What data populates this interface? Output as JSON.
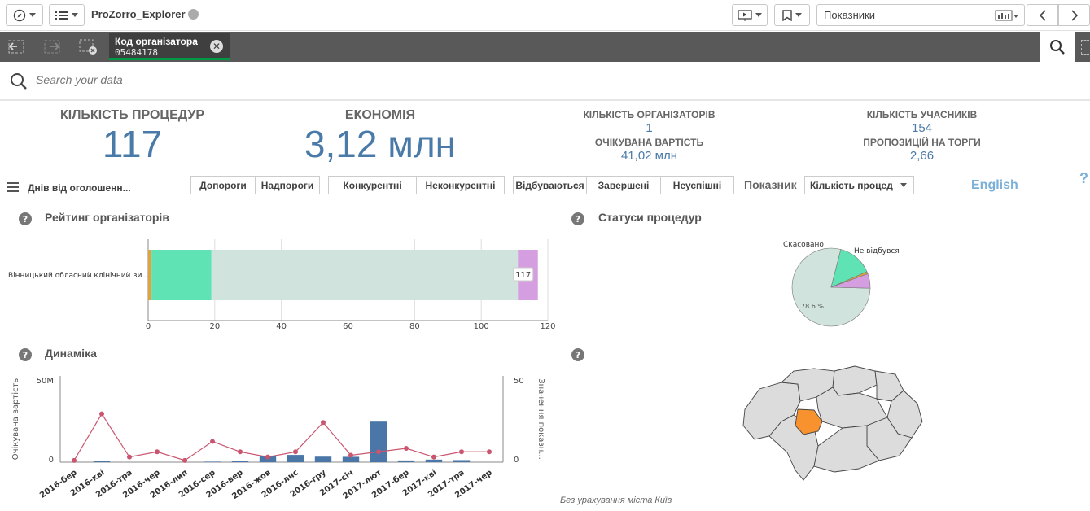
{
  "toolbar": {
    "app_title": "ProZorro_Explorer",
    "sheet_name": "Показники"
  },
  "selection": {
    "field": "Код організатора",
    "value": "05484178"
  },
  "search": {
    "placeholder": "Search your data"
  },
  "kpis": {
    "procedures_title": "КІЛЬКІСТЬ ПРОЦЕДУР",
    "procedures_value": "117",
    "savings_title": "ЕКОНОМІЯ",
    "savings_value": "3,12 млн",
    "organizers_title": "КІЛЬКІСТЬ ОРГАНІЗАТОРІВ",
    "organizers_value": "1",
    "expected_title": "ОЧІКУВАНА ВАРТІСТЬ",
    "expected_value": "41,02 млн",
    "participants_title": "КІЛЬКІСТЬ УЧАСНИКІВ",
    "participants_value": "154",
    "bids_title": "ПРОПОЗИЦІЙ НА ТОРГИ",
    "bids_value": "2,66"
  },
  "filters": {
    "days_label": "Днів від оголошенн...",
    "threshold": [
      "Допороги",
      "Надпороги"
    ],
    "competition": [
      "Конкурентні",
      "Неконкурентні"
    ],
    "status": [
      "Відбуваються",
      "Завершені",
      "Неуспішні"
    ],
    "indicator_label": "Показник",
    "indicator_value": "Кількість процед",
    "language_link": "English",
    "help_link": "?"
  },
  "panels": {
    "rating_title": "Рейтинг організаторів",
    "status_title": "Статуси процедур",
    "dynamics_title": "Динаміка",
    "map_note": "Без урахування міста Київ"
  },
  "colors": {
    "accent_blue": "#4a7ba8",
    "selection_green": "#009845",
    "map_highlight": "#f7922e"
  },
  "chart_data": [
    {
      "type": "bar",
      "orientation": "horizontal",
      "stacked": true,
      "categories": [
        "Вінницький обласний клінічний ви..."
      ],
      "series": [
        {
          "color": "#e3a33a",
          "values": [
            1
          ]
        },
        {
          "color": "#5fe3b4",
          "values": [
            18
          ]
        },
        {
          "color": "#d0e3dc",
          "values": [
            92
          ]
        },
        {
          "color": "#d59ee0",
          "values": [
            6
          ]
        }
      ],
      "total_labels": [
        "117"
      ],
      "xticks": [
        0,
        20,
        40,
        60,
        80,
        100,
        120
      ],
      "xlim": [
        0,
        120
      ]
    },
    {
      "type": "pie",
      "labels": [
        "Скасовано",
        "Не відбувся"
      ],
      "slices": [
        {
          "label": "",
          "value": 78.6,
          "color": "#d0e3dc",
          "data_label": "78.6 %"
        },
        {
          "label": "Не відбувся",
          "value": 14.5,
          "color": "#5fe3b4",
          "data_label": ""
        },
        {
          "label": "",
          "value": 0.9,
          "color": "#e3a33a",
          "data_label": ""
        },
        {
          "label": "Скасовано",
          "value": 6.0,
          "color": "#d59ee0",
          "data_label": ""
        }
      ]
    },
    {
      "type": "bar",
      "combo": true,
      "categories": [
        "2016-бер",
        "2016-кві",
        "2016-тра",
        "2016-чер",
        "2016-лип",
        "2016-сер",
        "2016-вер",
        "2016-жов",
        "2016-лис",
        "2016-гру",
        "2017-січ",
        "2017-лют",
        "2017-бер",
        "2017-кві",
        "2017-тра",
        "2017-чер"
      ],
      "ylabel": "Очікувана вартість",
      "y2label": "Значення показн...",
      "y_ticks": [
        "0",
        "50M"
      ],
      "y2_ticks": [
        "0",
        "50"
      ],
      "ylim": [
        0,
        50000000
      ],
      "y2lim": [
        0,
        50
      ],
      "series": [
        {
          "type": "bar",
          "color": "#4a76a8",
          "values": [
            0,
            500000,
            0,
            0,
            0,
            300000,
            500000,
            3800000,
            4200000,
            3200000,
            3100000,
            23500000,
            1000000,
            1500000,
            1200000,
            0
          ]
        },
        {
          "type": "line",
          "color": "#c9556f",
          "values": [
            1,
            28,
            3,
            6,
            1,
            12,
            6,
            3,
            6,
            23,
            4,
            6,
            8,
            3,
            6,
            6
          ]
        }
      ]
    }
  ]
}
